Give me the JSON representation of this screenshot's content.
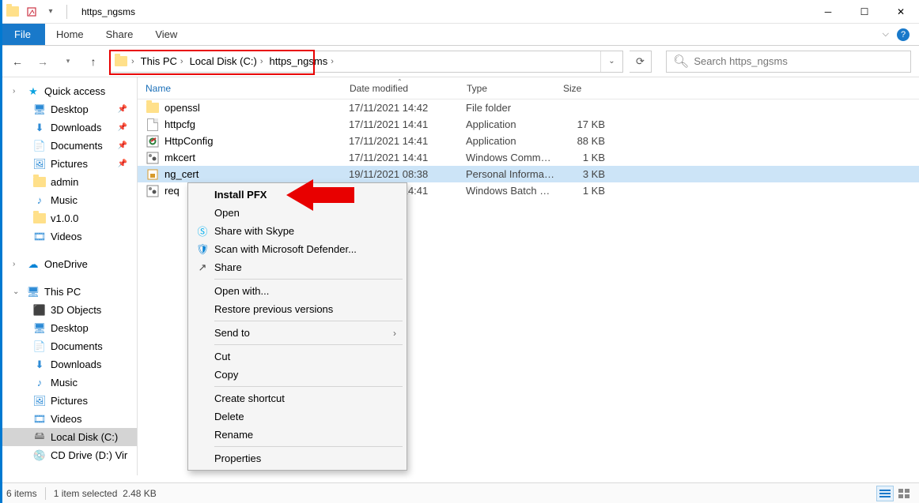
{
  "title": "https_ngsms",
  "ribbon": {
    "file": "File",
    "home": "Home",
    "share": "Share",
    "view": "View"
  },
  "breadcrumb": [
    "This PC",
    "Local Disk (C:)",
    "https_ngsms"
  ],
  "search": {
    "placeholder": "Search https_ngsms"
  },
  "columns": {
    "name": "Name",
    "date": "Date modified",
    "type": "Type",
    "size": "Size"
  },
  "files": [
    {
      "name": "openssl",
      "date": "17/11/2021 14:42",
      "type": "File folder",
      "size": "",
      "icon": "folder"
    },
    {
      "name": "httpcfg",
      "date": "17/11/2021 14:41",
      "type": "Application",
      "size": "17 KB",
      "icon": "doc"
    },
    {
      "name": "HttpConfig",
      "date": "17/11/2021 14:41",
      "type": "Application",
      "size": "88 KB",
      "icon": "httpcfg"
    },
    {
      "name": "mkcert",
      "date": "17/11/2021 14:41",
      "type": "Windows Comma...",
      "size": "1 KB",
      "icon": "cmd"
    },
    {
      "name": "ng_cert",
      "date": "19/11/2021 08:38",
      "type": "Personal Informati...",
      "size": "3 KB",
      "icon": "pfx",
      "selected": true
    },
    {
      "name": "req",
      "date": "17/11/2021 14:41",
      "type": "Windows Batch File",
      "size": "1 KB",
      "icon": "cmd"
    }
  ],
  "sidebar": {
    "quick_access": "Quick access",
    "onedrive": "OneDrive",
    "this_pc": "This PC",
    "qa_items": [
      "Desktop",
      "Downloads",
      "Documents",
      "Pictures",
      "admin",
      "Music",
      "v1.0.0",
      "Videos"
    ],
    "pc_items": [
      "3D Objects",
      "Desktop",
      "Documents",
      "Downloads",
      "Music",
      "Pictures",
      "Videos",
      "Local Disk (C:)",
      "CD Drive (D:) Vir"
    ]
  },
  "context_menu": {
    "install": "Install PFX",
    "open": "Open",
    "skype": "Share with Skype",
    "defender": "Scan with Microsoft Defender...",
    "share": "Share",
    "openwith": "Open with...",
    "restore": "Restore previous versions",
    "sendto": "Send to",
    "cut": "Cut",
    "copy": "Copy",
    "shortcut": "Create shortcut",
    "delete": "Delete",
    "rename": "Rename",
    "properties": "Properties"
  },
  "status": {
    "items": "6 items",
    "selected": "1 item selected",
    "size": "2.48 KB"
  }
}
